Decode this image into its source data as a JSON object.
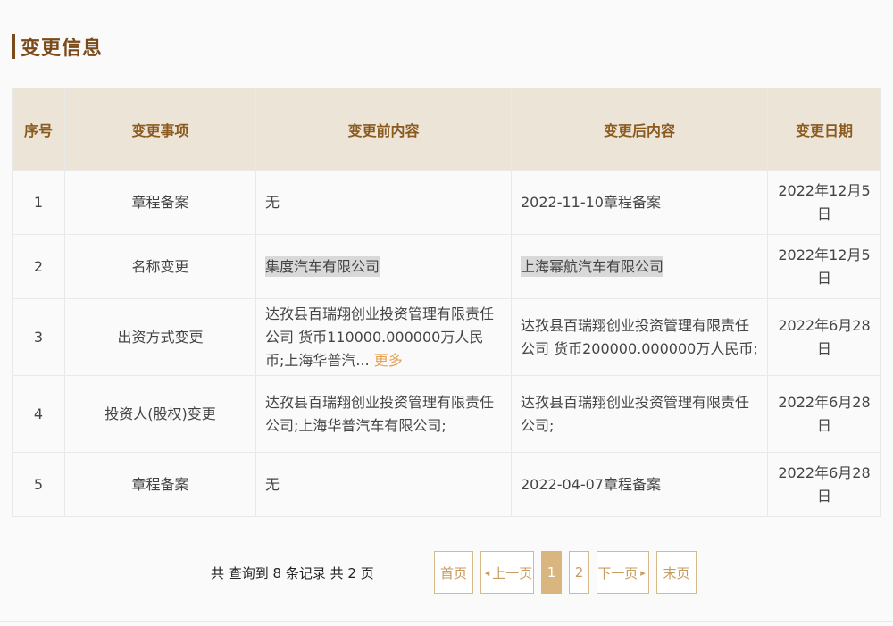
{
  "section": {
    "title": "变更信息"
  },
  "table": {
    "headers": [
      "序号",
      "变更事项",
      "变更前内容",
      "变更后内容",
      "变更日期"
    ],
    "rows": [
      {
        "no": "1",
        "item": "章程备案",
        "before": "无",
        "after": "2022-11-10章程备案",
        "date": "2022年12月5日"
      },
      {
        "no": "2",
        "item": "名称变更",
        "before": "集度汽车有限公司",
        "after": "上海幂航汽车有限公司",
        "date": "2022年12月5日"
      },
      {
        "no": "3",
        "item": "出资方式变更",
        "before": "达孜县百瑞翔创业投资管理有限责任公司 货币110000.000000万人民币;上海华普汽...",
        "more": "更多",
        "after": "达孜县百瑞翔创业投资管理有限责任公司 货币200000.000000万人民币;",
        "date": "2022年6月28日"
      },
      {
        "no": "4",
        "item": "投资人(股权)变更",
        "before": "达孜县百瑞翔创业投资管理有限责任公司;上海华普汽车有限公司;",
        "after": "达孜县百瑞翔创业投资管理有限责任公司;",
        "date": "2022年6月28日"
      },
      {
        "no": "5",
        "item": "章程备案",
        "before": "无",
        "after": "2022-04-07章程备案",
        "date": "2022年6月28日"
      }
    ]
  },
  "pagination": {
    "total_text": "共 查询到 8 条记录 共 2 页",
    "first": "首页",
    "prev": "上一页",
    "pages": [
      "1",
      "2"
    ],
    "current": "1",
    "next": "下一页",
    "last": "末页"
  },
  "icons": {
    "prev": "chevron-left-icon",
    "next": "chevron-right-icon"
  },
  "colors": {
    "accent": "#8b5a1f",
    "header_bg": "#ece5d7",
    "pager_border": "#d7b98a",
    "pager_active": "#d9b57f",
    "more_link": "#e8a04f"
  }
}
